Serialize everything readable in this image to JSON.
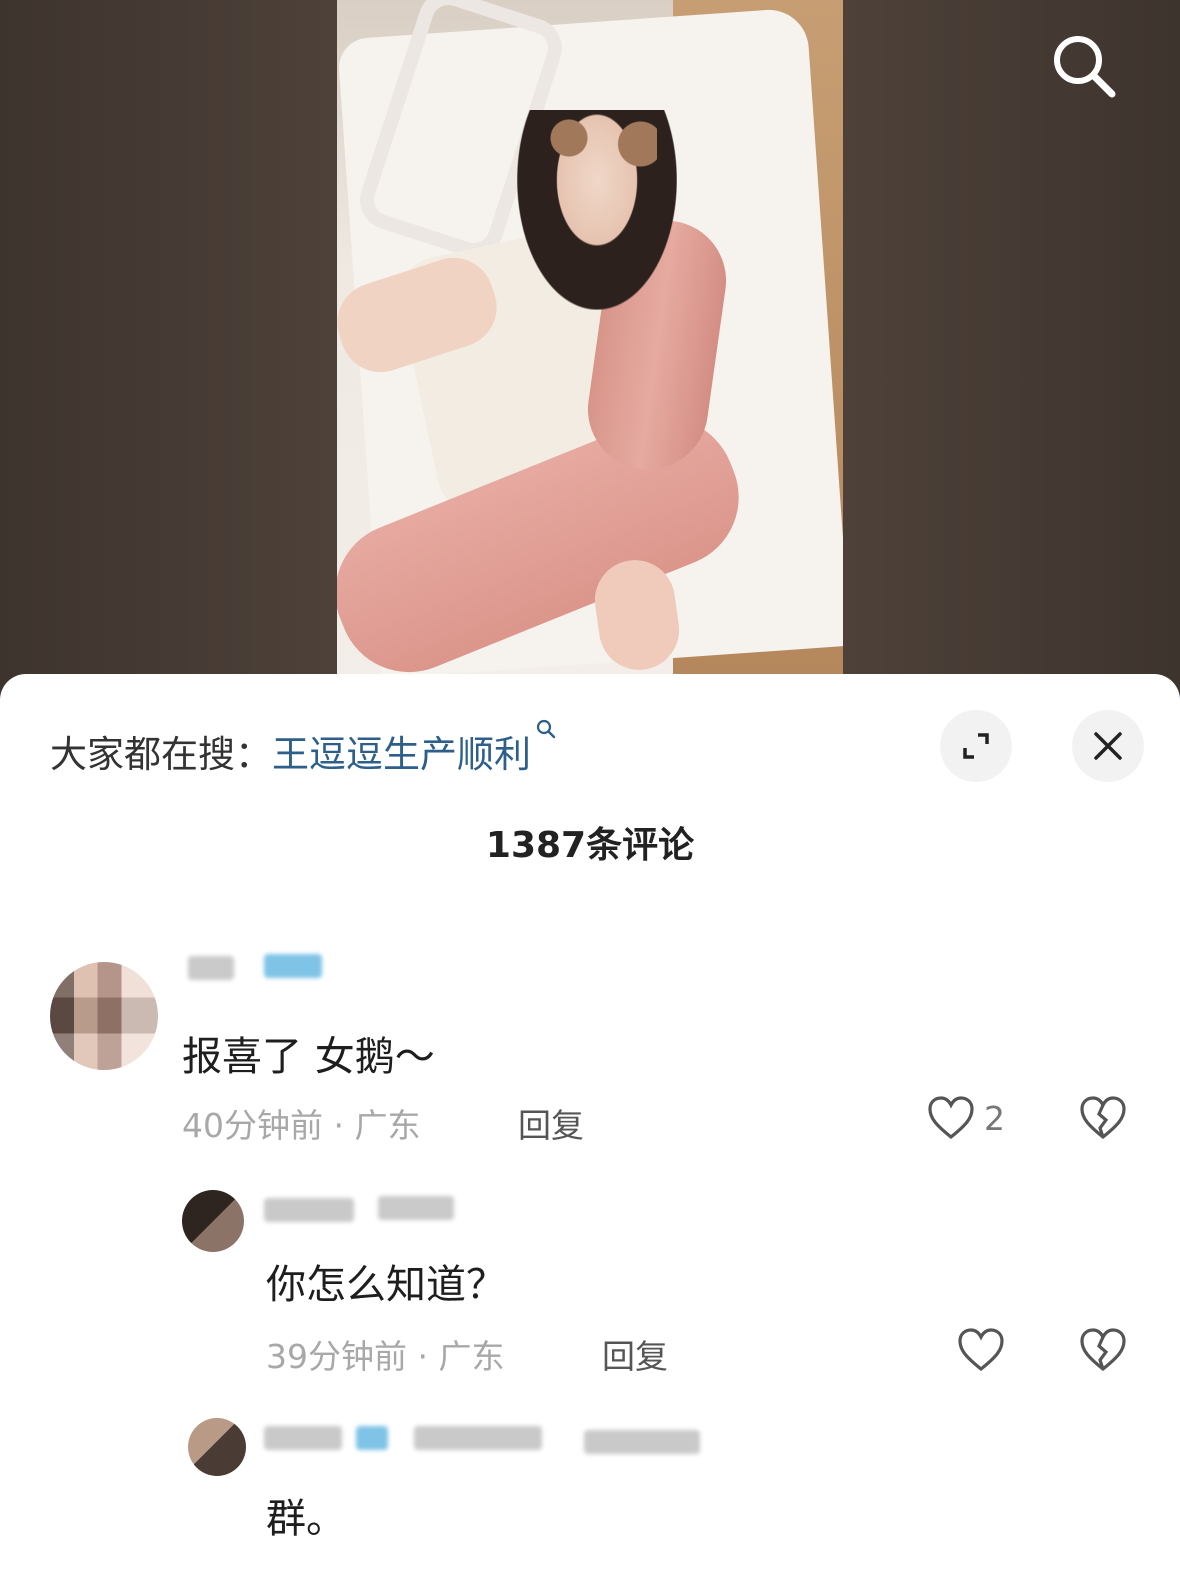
{
  "search_bar": {
    "prefix": "大家都在搜：",
    "query": "王逗逗生产顺利"
  },
  "comments_header": {
    "title": "1387条评论"
  },
  "comments": [
    {
      "text": "报喜了 女鹅～",
      "time": "40分钟前",
      "location": "广东",
      "reply_label": "回复",
      "likes": "2"
    },
    {
      "text": "你怎么知道？",
      "time": "39分钟前",
      "location": "广东",
      "reply_label": "回复",
      "likes": ""
    },
    {
      "text": "群。"
    }
  ],
  "colors": {
    "link": "#2d5f8a",
    "meta": "#a8a8a8",
    "sheet": "#ffffff"
  },
  "icons": [
    "search-icon",
    "expand-icon",
    "close-icon",
    "heart-icon",
    "broken-heart-icon"
  ]
}
